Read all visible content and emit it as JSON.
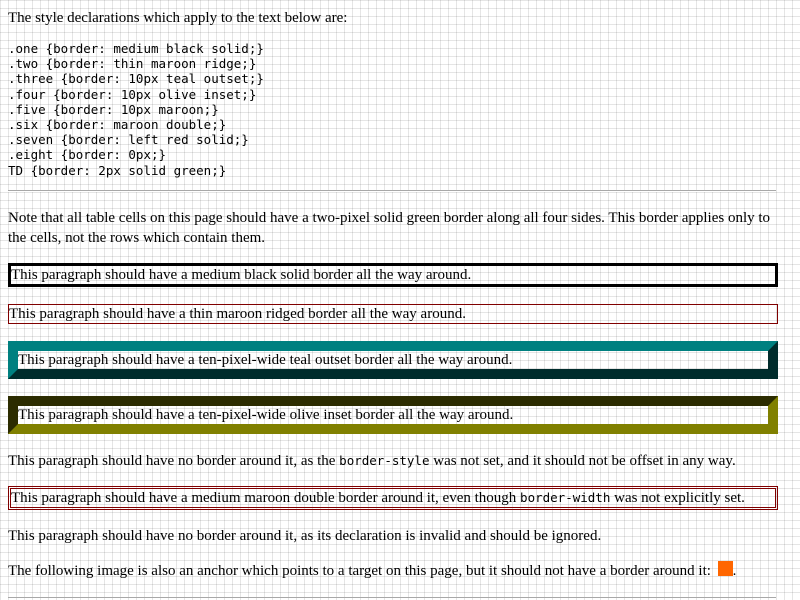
{
  "intro": "The style declarations which apply to the text below are:",
  "styles": [
    ".one {border: medium black solid;}",
    ".two {border: thin maroon ridge;}",
    ".three {border: 10px teal outset;}",
    ".four {border: 10px olive inset;}",
    ".five {border: 10px maroon;}",
    ".six {border: maroon double;}",
    ".seven {border: left red solid;}",
    ".eight {border: 0px;}",
    "TD {border: 2px solid green;}"
  ],
  "note": "Note that all table cells on this page should have a two-pixel solid green border along all four sides. This border applies only to the cells, not the rows which contain them.",
  "paragraphs": {
    "one": "This paragraph should have a medium black solid border all the way around.",
    "two": "This paragraph should have a thin maroon ridged border all the way around.",
    "three": "This paragraph should have a ten-pixel-wide teal outset border all the way around.",
    "four": "This paragraph should have a ten-pixel-wide olive inset border all the way around.",
    "five_pre": "This paragraph should have no border around it, as the ",
    "five_code": "border-style",
    "five_post": " was not set, and it should not be offset in any way.",
    "six_pre": "This paragraph should have a medium maroon double border around it, even though ",
    "six_code": "border-width",
    "six_post": " was not explicitly set.",
    "seven": "This paragraph should have no border around it, as its declaration is invalid and should be ignored.",
    "eight_pre": "The following image is also an anchor which points to a target on this page, but it should not have a border around it: ",
    "eight_post": "."
  },
  "colors": {
    "black": "#000000",
    "maroon": "#800000",
    "teal": "#008080",
    "olive": "#808000",
    "anchor_image": "#ff6600"
  },
  "icons": {
    "anchor_image": "orange-square-image"
  }
}
